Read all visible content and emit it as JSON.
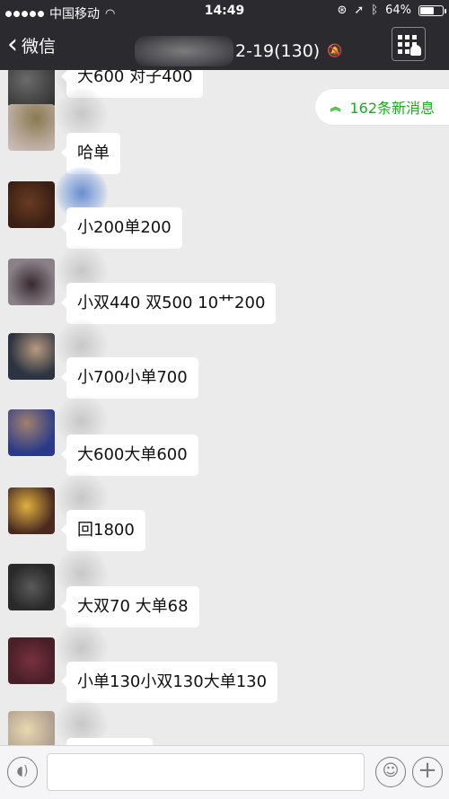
{
  "status_bar": {
    "carrier": "中国移动",
    "time": "14:49",
    "battery": "64%",
    "battery_level": 0.64
  },
  "nav": {
    "back_label": "微信",
    "title_count": "2-19(130)"
  },
  "new_messages": {
    "label": "162条新消息"
  },
  "messages": [
    {
      "text": "大600 对子400"
    },
    {
      "text": "哈单"
    },
    {
      "text": "小200单200"
    },
    {
      "text": "小双440 双500 10艹200"
    },
    {
      "text": "小700小单700"
    },
    {
      "text": "大600大单600"
    },
    {
      "text": "回1800"
    },
    {
      "text": "大双70 大单68"
    },
    {
      "text": "小单130小双130大单130"
    }
  ],
  "input_bar": {
    "placeholder": ""
  },
  "colors": {
    "bar": "#2a2a2f",
    "chat_bg": "#ebebeb",
    "accent_green": "#1aad19"
  }
}
